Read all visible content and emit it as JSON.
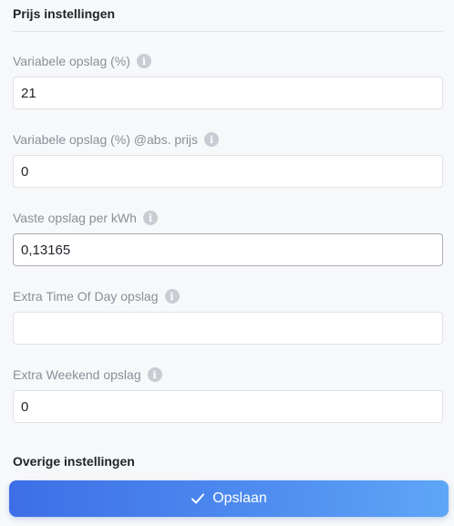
{
  "sections": {
    "price_settings_title": "Prijs instellingen",
    "other_settings_title": "Overige instellingen"
  },
  "fields": [
    {
      "label": "Variabele opslag (%)",
      "value": "21",
      "placeholder": ""
    },
    {
      "label": "Variabele opslag (%) @abs. prijs",
      "value": "0",
      "placeholder": ""
    },
    {
      "label": "Vaste opslag per kWh",
      "value": "0,13165",
      "placeholder": ""
    },
    {
      "label": "Extra Time Of Day opslag",
      "value": "",
      "placeholder": ""
    },
    {
      "label": "Extra Weekend opslag",
      "value": "0",
      "placeholder": ""
    }
  ],
  "icons": {
    "info": "info-icon",
    "save": "check-icon",
    "info_glyph": "i"
  },
  "save_button": {
    "label": "Opslaan"
  },
  "colors": {
    "accent_start": "#3d6ee6",
    "accent_end": "#5ea6f7"
  }
}
